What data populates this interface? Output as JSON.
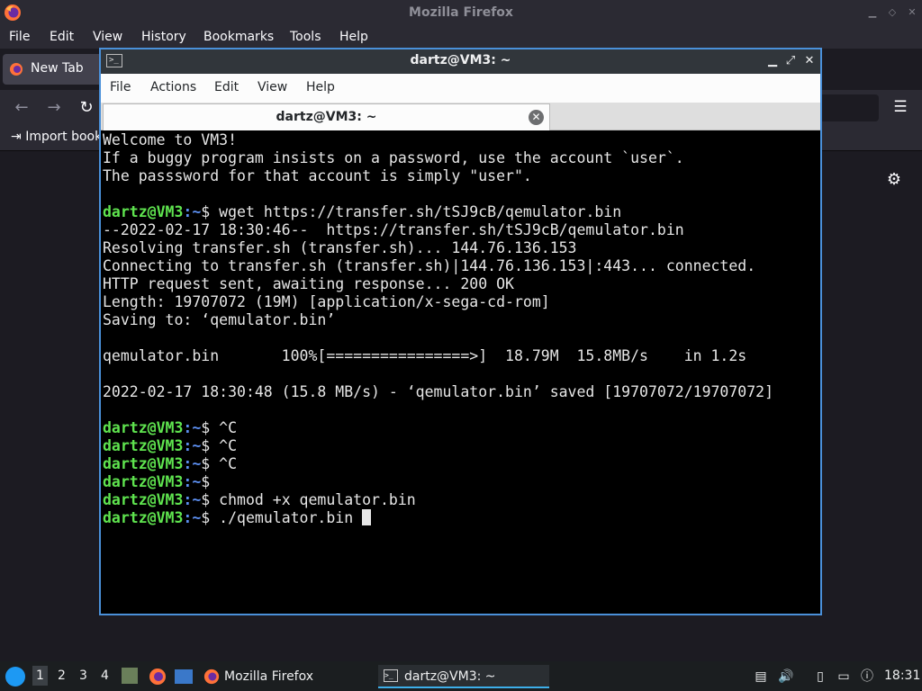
{
  "firefox": {
    "window_title": "Mozilla Firefox",
    "menu": [
      "File",
      "Edit",
      "View",
      "History",
      "Bookmarks",
      "Tools",
      "Help"
    ],
    "tab_label": "New Tab",
    "bookmark_label": "Import book"
  },
  "terminal": {
    "window_title": "dartz@VM3: ~",
    "menu": [
      "File",
      "Actions",
      "Edit",
      "View",
      "Help"
    ],
    "tab_label": "dartz@VM3: ~",
    "prompt_user": "dartz@VM3",
    "prompt_path": ":~",
    "prompt_symbol": "$ ",
    "lines": [
      {
        "type": "text",
        "text": "Welcome to VM3!"
      },
      {
        "type": "text",
        "text": "If a buggy program insists on a password, use the account `user`."
      },
      {
        "type": "text",
        "text": "The passsword for that account is simply \"user\"."
      },
      {
        "type": "text",
        "text": ""
      },
      {
        "type": "prompt",
        "cmd": "wget https://transfer.sh/tSJ9cB/qemulator.bin"
      },
      {
        "type": "text",
        "text": "--2022-02-17 18:30:46--  https://transfer.sh/tSJ9cB/qemulator.bin"
      },
      {
        "type": "text",
        "text": "Resolving transfer.sh (transfer.sh)... 144.76.136.153"
      },
      {
        "type": "text",
        "text": "Connecting to transfer.sh (transfer.sh)|144.76.136.153|:443... connected."
      },
      {
        "type": "text",
        "text": "HTTP request sent, awaiting response... 200 OK"
      },
      {
        "type": "text",
        "text": "Length: 19707072 (19M) [application/x-sega-cd-rom]"
      },
      {
        "type": "text",
        "text": "Saving to: ‘qemulator.bin’"
      },
      {
        "type": "text",
        "text": ""
      },
      {
        "type": "text",
        "text": "qemulator.bin       100%[================>]  18.79M  15.8MB/s    in 1.2s"
      },
      {
        "type": "text",
        "text": ""
      },
      {
        "type": "text",
        "text": "2022-02-17 18:30:48 (15.8 MB/s) - ‘qemulator.bin’ saved [19707072/19707072]"
      },
      {
        "type": "text",
        "text": ""
      },
      {
        "type": "prompt",
        "cmd": "^C"
      },
      {
        "type": "prompt",
        "cmd": "^C"
      },
      {
        "type": "prompt",
        "cmd": "^C"
      },
      {
        "type": "prompt",
        "cmd": ""
      },
      {
        "type": "prompt",
        "cmd": "chmod +x qemulator.bin"
      },
      {
        "type": "prompt",
        "cmd": "./qemulator.bin ",
        "cursor": true
      }
    ]
  },
  "taskbar": {
    "workspaces": [
      "1",
      "2",
      "3",
      "4"
    ],
    "apps": [
      {
        "label": "Mozilla Firefox",
        "icon": "firefox-icon"
      },
      {
        "label": "dartz@VM3: ~",
        "icon": "terminal-icon"
      }
    ],
    "clock": "18:31"
  },
  "colors": {
    "prompt_user": "#5fe44f",
    "prompt_path": "#5c8ff0",
    "terminal_bg": "#000000",
    "window_border": "#4a90d9"
  }
}
